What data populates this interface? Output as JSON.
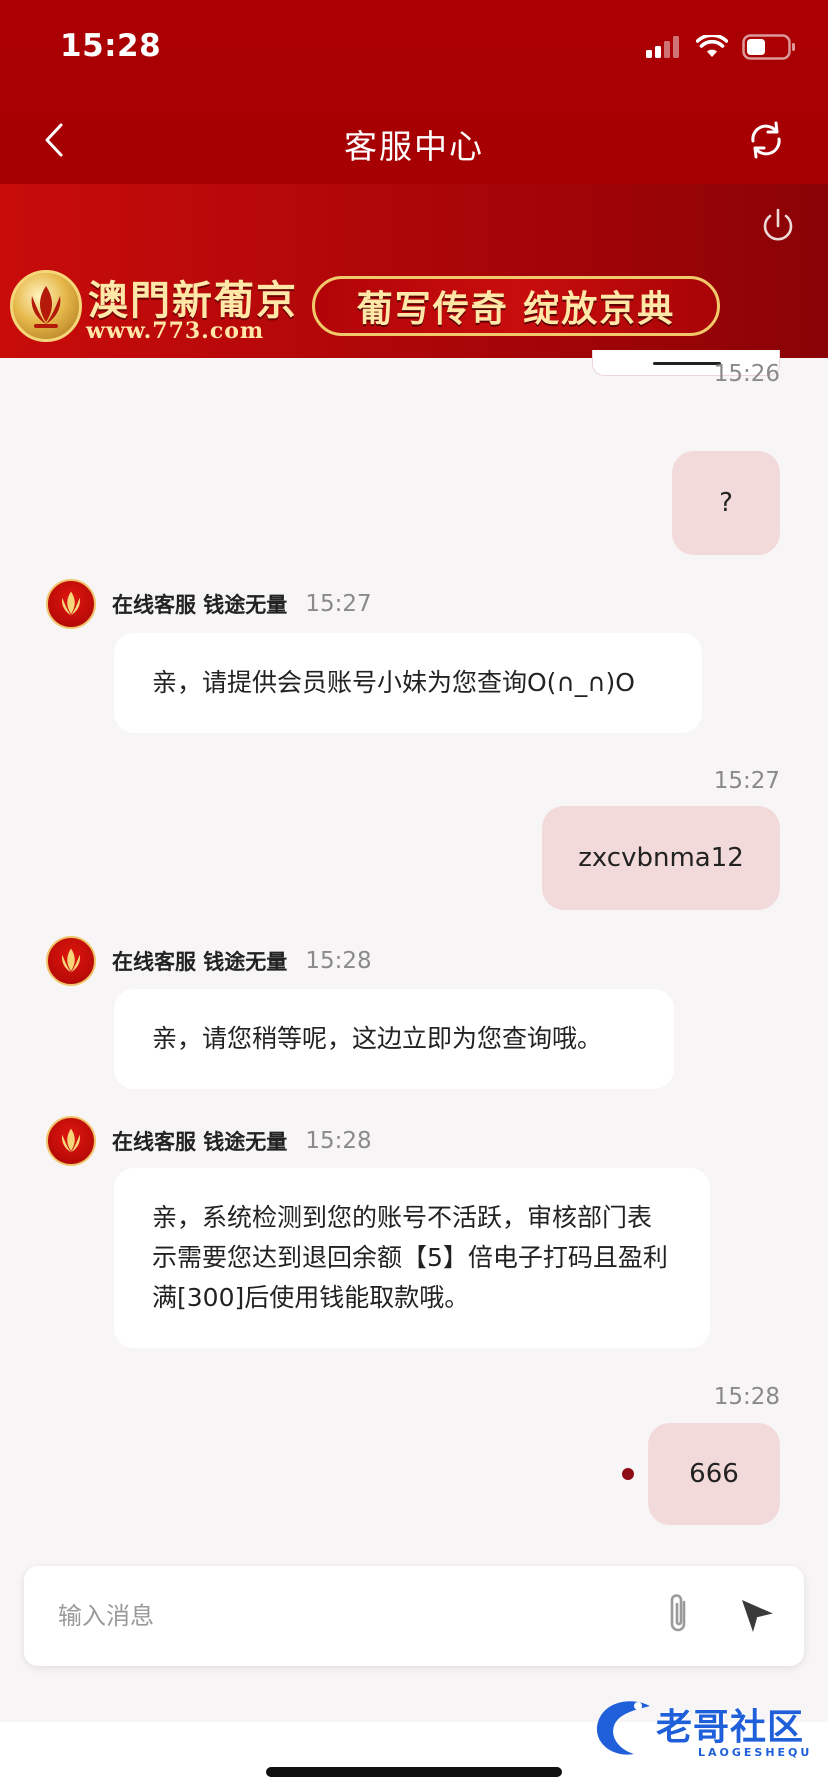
{
  "status_bar": {
    "time": "15:28"
  },
  "nav": {
    "title": "客服中心"
  },
  "banner": {
    "brand": "澳門新葡京",
    "url": "www.773.com",
    "slogan": "葡写传奇 绽放京典"
  },
  "messages": [
    {
      "from": "user",
      "time": "15:26",
      "text": "?"
    },
    {
      "from": "agent",
      "agent_name": "在线客服 钱途无量",
      "time": "15:27",
      "text": "亲，请提供会员账号小妹为您查询O(∩_∩)O"
    },
    {
      "from": "user",
      "time": "15:27",
      "text": "zxcvbnma12"
    },
    {
      "from": "agent",
      "agent_name": "在线客服 钱途无量",
      "time": "15:28",
      "text": "亲，请您稍等呢，这边立即为您查询哦。"
    },
    {
      "from": "agent",
      "agent_name": "在线客服 钱途无量",
      "time": "15:28",
      "text": "亲，系统检测到您的账号不活跃，审核部门表示需要您达到退回余额【5】倍电子打码且盈利满[300]后使用钱能取款哦。"
    },
    {
      "from": "user",
      "time": "15:28",
      "text": "666"
    }
  ],
  "input": {
    "placeholder": "输入消息",
    "value": ""
  },
  "watermark": {
    "text": "老哥社区",
    "sub": "LAOGESHEQU"
  },
  "icons": {
    "back": "chevron-left-icon",
    "refresh": "refresh-icon",
    "power": "power-icon",
    "attach": "paperclip-icon",
    "send": "send-icon"
  },
  "colors": {
    "header_red": "#a80003",
    "user_bubble": "#f3dada",
    "agent_bubble": "#ffffff",
    "background": "#f7f5f5",
    "gold": "#ffe7a8"
  }
}
